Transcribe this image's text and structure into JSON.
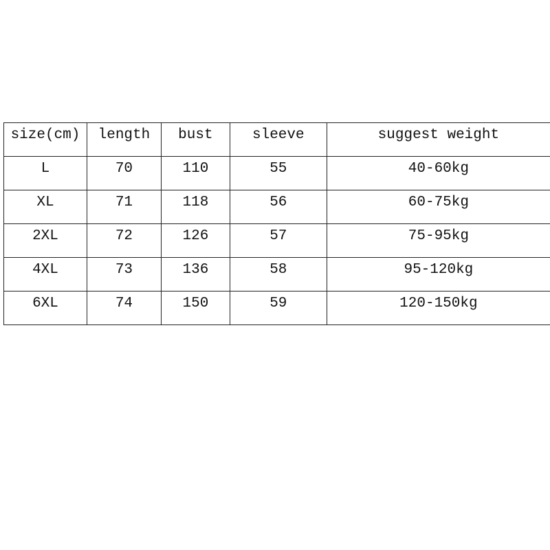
{
  "table": {
    "headers": [
      "size(cm)",
      "length",
      "bust",
      "sleeve",
      "suggest weight"
    ],
    "rows": [
      [
        "L",
        "70",
        "110",
        "55",
        "40-60kg"
      ],
      [
        "XL",
        "71",
        "118",
        "56",
        "60-75kg"
      ],
      [
        "2XL",
        "72",
        "126",
        "57",
        "75-95kg"
      ],
      [
        "4XL",
        "73",
        "136",
        "58",
        "95-120kg"
      ],
      [
        "6XL",
        "74",
        "150",
        "59",
        "120-150kg"
      ]
    ]
  }
}
